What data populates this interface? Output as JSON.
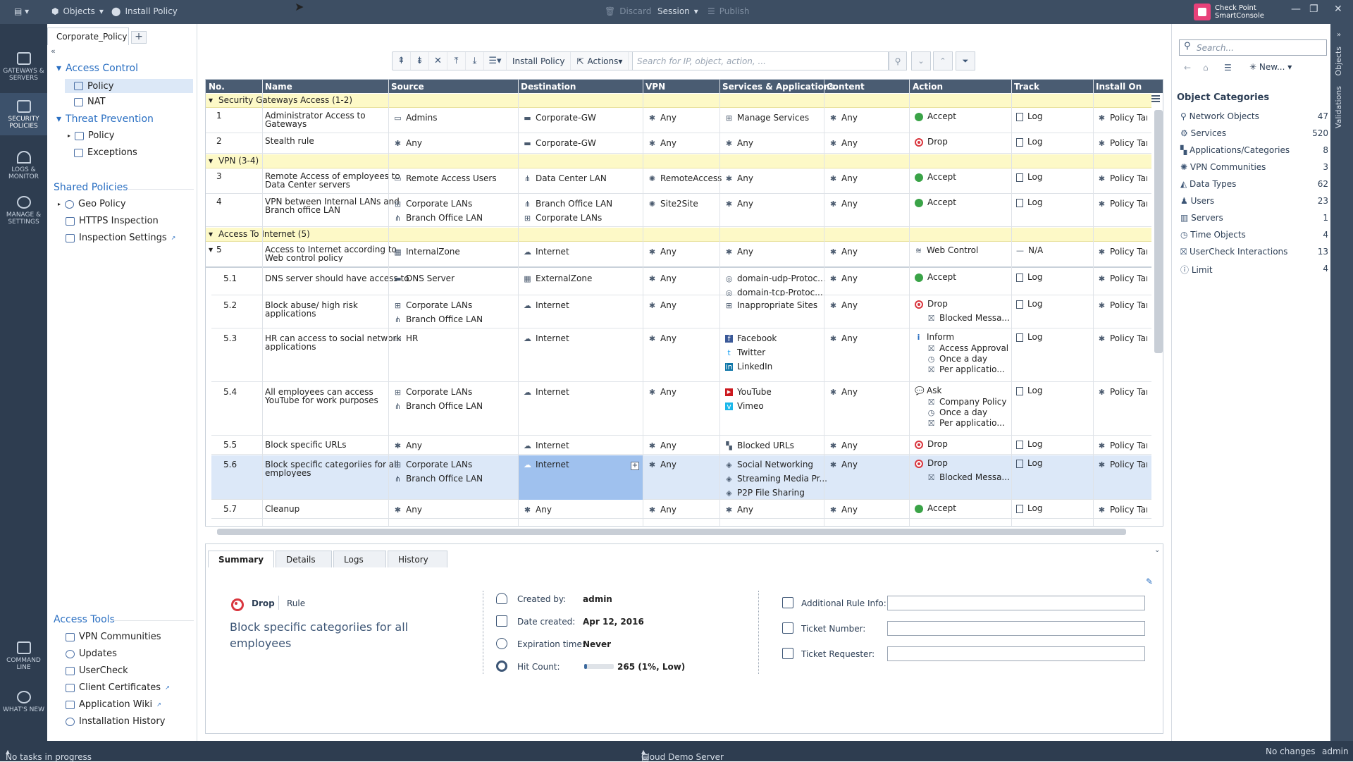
{
  "topbar": {
    "objects": "Objects",
    "install_policy": "Install Policy",
    "discard": "Discard",
    "session": "Session",
    "publish": "Publish",
    "brand_line1": "Check Point",
    "brand_line2": "SmartConsole"
  },
  "leftnav": {
    "gateways": "GATEWAYS & SERVERS",
    "security": "SECURITY POLICIES",
    "logs": "LOGS & MONITOR",
    "manage": "MANAGE & SETTINGS",
    "cmdline": "COMMAND LINE",
    "whatsnew": "WHAT'S NEW"
  },
  "policy_tab": "Corporate_Policy",
  "tree": {
    "access_control": "Access Control",
    "policy": "Policy",
    "nat": "NAT",
    "threat_prevention": "Threat Prevention",
    "tp_policy": "Policy",
    "exceptions": "Exceptions",
    "shared_policies": "Shared Policies",
    "geo_policy": "Geo Policy",
    "https_inspection": "HTTPS Inspection",
    "inspection_settings": "Inspection Settings",
    "access_tools": "Access Tools",
    "vpn_communities": "VPN Communities",
    "updates": "Updates",
    "usercheck": "UserCheck",
    "client_certificates": "Client Certificates",
    "application_wiki": "Application Wiki",
    "installation_history": "Installation History"
  },
  "toolbar": {
    "install_policy": "Install Policy",
    "actions": "Actions",
    "search_placeholder": "Search for IP, object, action, ..."
  },
  "columns": [
    "No.",
    "Name",
    "Source",
    "Destination",
    "VPN",
    "Services & Applications",
    "Content",
    "Action",
    "Track",
    "Install On"
  ],
  "sections": {
    "s1": "Security Gateways Access (1-2)",
    "s2": "VPN (3-4)",
    "s3": "Access To Internet (5)"
  },
  "rules": {
    "r1": {
      "no": "1",
      "name1": "Administrator Access to",
      "name2": "Gateways",
      "src": "Admins",
      "dst": "Corporate-GW",
      "vpn": "Any",
      "svc": "Manage Services",
      "content": "Any",
      "action": "Accept",
      "track": "Log",
      "install": "Policy Targets"
    },
    "r2": {
      "no": "2",
      "name1": "Stealth rule",
      "src": "Any",
      "dst": "Corporate-GW",
      "vpn": "Any",
      "svc": "Any",
      "content": "Any",
      "action": "Drop",
      "track": "Log",
      "install": "Policy Targets"
    },
    "r3": {
      "no": "3",
      "name1": "Remote Access of employees to",
      "name2": "Data Center servers",
      "src": "Remote Access Users",
      "dst": "Data Center LAN",
      "vpn": "RemoteAccess",
      "svc": "Any",
      "content": "Any",
      "action": "Accept",
      "track": "Log",
      "install": "Policy Targets"
    },
    "r4": {
      "no": "4",
      "name1": "VPN between Internal LANs and",
      "name2": "Branch office LAN",
      "src1": "Corporate LANs",
      "src2": "Branch Office LAN",
      "dst1": "Branch Office LAN",
      "dst2": "Corporate LANs",
      "vpn": "Site2Site",
      "svc": "Any",
      "content": "Any",
      "action": "Accept",
      "track": "Log",
      "install": "Policy Targets"
    },
    "r5": {
      "no": "5",
      "name1": "Access to Internet according to",
      "name2": "Web control policy",
      "src": "InternalZone",
      "dst": "Internet",
      "vpn": "Any",
      "svc": "Any",
      "content": "Any",
      "action": "Web Control",
      "track": "N/A",
      "install": "Policy Targets"
    },
    "r51": {
      "no": "5.1",
      "name1": "DNS server should have access to",
      "src": "DNS Server",
      "dst": "ExternalZone",
      "vpn": "Any",
      "svc1": "domain-udp-Protoc...",
      "svc2": "domain-tcp-Protoc...",
      "content": "Any",
      "action": "Accept",
      "track": "Log",
      "install": "Policy Targets"
    },
    "r52": {
      "no": "5.2",
      "name1": "Block abuse/ high risk",
      "name2": "applications",
      "src1": "Corporate LANs",
      "src2": "Branch Office LAN",
      "dst": "Internet",
      "vpn": "Any",
      "svc": "Inappropriate Sites",
      "content": "Any",
      "action": "Drop",
      "action2": "Blocked Messa...",
      "track": "Log",
      "install": "Policy Targets"
    },
    "r53": {
      "no": "5.3",
      "name1": "HR can access to social network",
      "name2": "applications",
      "src": "HR",
      "dst": "Internet",
      "vpn": "Any",
      "svc1": "Facebook",
      "svc2": "Twitter",
      "svc3": "LinkedIn",
      "content": "Any",
      "action": "Inform",
      "action2": "Access Approval",
      "action3": "Once a day",
      "action4": "Per applicatio...",
      "track": "Log",
      "install": "Policy Targets"
    },
    "r54": {
      "no": "5.4",
      "name1": "All employees can access",
      "name2": "YouTube for work purposes",
      "src1": "Corporate LANs",
      "src2": "Branch Office LAN",
      "dst": "Internet",
      "vpn": "Any",
      "svc1": "YouTube",
      "svc2": "Vimeo",
      "content": "Any",
      "action": "Ask",
      "action2": "Company Policy",
      "action3": "Once a day",
      "action4": "Per applicatio...",
      "track": "Log",
      "install": "Policy Targets"
    },
    "r55": {
      "no": "5.5",
      "name1": "Block specific URLs",
      "src": "Any",
      "dst": "Internet",
      "vpn": "Any",
      "svc": "Blocked URLs",
      "content": "Any",
      "action": "Drop",
      "track": "Log",
      "install": "Policy Targets"
    },
    "r56": {
      "no": "5.6",
      "name1": "Block specific categoriies for all",
      "name2": "employees",
      "src1": "Corporate LANs",
      "src2": "Branch Office LAN",
      "dst": "Internet",
      "vpn": "Any",
      "svc1": "Social Networking",
      "svc2": "Streaming Media Pr...",
      "svc3": "P2P File Sharing",
      "content": "Any",
      "action": "Drop",
      "action2": "Blocked Messa...",
      "track": "Log",
      "install": "Policy Targets"
    },
    "r57": {
      "no": "5.7",
      "name1": "Cleanup",
      "src": "Any",
      "dst": "Any",
      "vpn": "Any",
      "svc": "Any",
      "content": "Any",
      "action": "Accept",
      "track": "Log",
      "install": "Policy Targets"
    }
  },
  "detail": {
    "tabs": [
      "Summary",
      "Details",
      "Logs",
      "History"
    ],
    "action": "Drop",
    "rule_label": "Rule",
    "title": "Block specific categoriies for all employees",
    "created_by_label": "Created by:",
    "created_by": "admin",
    "date_created_label": "Date created:",
    "date_created": "Apr 12, 2016",
    "expiration_label": "Expiration time:",
    "expiration": "Never",
    "hit_count_label": "Hit Count:",
    "hit_count": "265 (1%, Low)",
    "hit_fraction": 0.01,
    "additional_info_label": "Additional Rule Info:",
    "ticket_number_label": "Ticket Number:",
    "ticket_requester_label": "Ticket Requester:"
  },
  "rightpanel": {
    "search_placeholder": "Search...",
    "new_label": "New...",
    "heading": "Object Categories",
    "categories": [
      {
        "label": "Network Objects",
        "count": "47"
      },
      {
        "label": "Services",
        "count": "520"
      },
      {
        "label": "Applications/Categories",
        "count": "8"
      },
      {
        "label": "VPN Communities",
        "count": "3"
      },
      {
        "label": "Data Types",
        "count": "62"
      },
      {
        "label": "Users",
        "count": "23"
      },
      {
        "label": "Servers",
        "count": "1"
      },
      {
        "label": "Time Objects",
        "count": "4"
      },
      {
        "label": "UserCheck Interactions",
        "count": "13"
      },
      {
        "label": "Limit",
        "count": "4"
      }
    ],
    "vtab_objects": "Objects",
    "vtab_validations": "Validations"
  },
  "status": {
    "tasks": "No tasks in progress",
    "server": "Cloud Demo Server",
    "changes": "No changes",
    "user": "admin"
  },
  "colors": {
    "accent": "#2a6fc2",
    "accept": "#3aa347",
    "drop": "#d9363e",
    "section": "#fdf9c7",
    "selected": "#dce8f8"
  }
}
